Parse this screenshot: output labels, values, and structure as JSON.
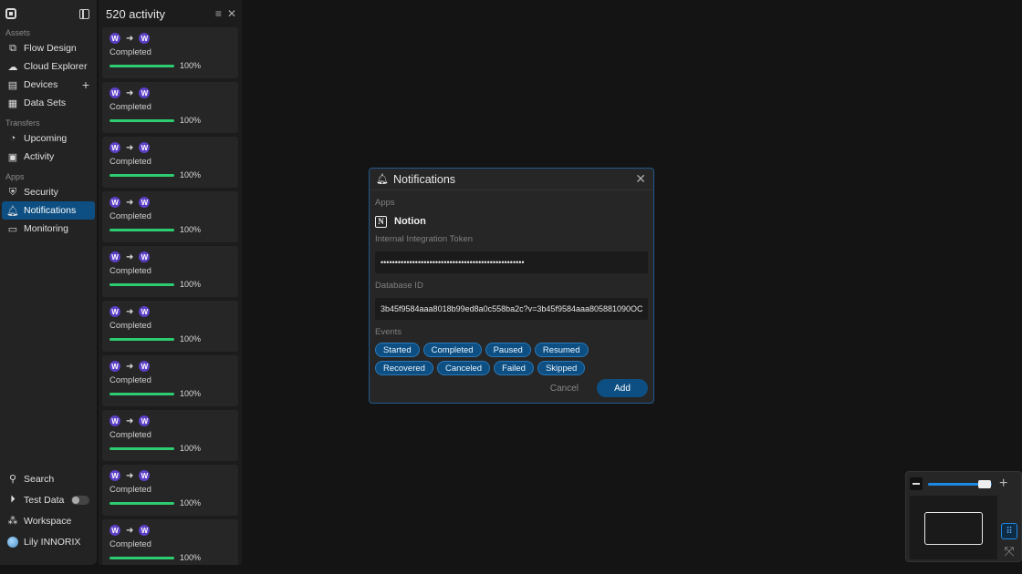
{
  "sidebar": {
    "sections": [
      {
        "label": "Assets",
        "items": [
          {
            "label": "Flow Design",
            "icon": "flow-icon"
          },
          {
            "label": "Cloud Explorer",
            "icon": "cloud-icon"
          },
          {
            "label": "Devices",
            "icon": "devices-icon"
          },
          {
            "label": "Data Sets",
            "icon": "dataset-icon"
          }
        ]
      },
      {
        "label": "Transfers",
        "items": [
          {
            "label": "Upcoming",
            "icon": "clock-icon"
          },
          {
            "label": "Activity",
            "icon": "activity-icon"
          }
        ]
      },
      {
        "label": "Apps",
        "items": [
          {
            "label": "Security",
            "icon": "shield-icon"
          },
          {
            "label": "Notifications",
            "icon": "bell-icon",
            "active": true
          },
          {
            "label": "Monitoring",
            "icon": "monitor-icon"
          }
        ]
      }
    ],
    "bottom": {
      "search": "Search",
      "test_data": "Test Data",
      "workspace": "Workspace",
      "user": "Lily INNORIX"
    }
  },
  "activity": {
    "title": "520  activity",
    "items": [
      {
        "from": "W",
        "to": "W",
        "status": "Completed",
        "progress": 100,
        "progress_label": "100%"
      },
      {
        "from": "W",
        "to": "W",
        "status": "Completed",
        "progress": 100,
        "progress_label": "100%"
      },
      {
        "from": "W",
        "to": "W",
        "status": "Completed",
        "progress": 100,
        "progress_label": "100%"
      },
      {
        "from": "W",
        "to": "W",
        "status": "Completed",
        "progress": 100,
        "progress_label": "100%"
      },
      {
        "from": "W",
        "to": "W",
        "status": "Completed",
        "progress": 100,
        "progress_label": "100%"
      },
      {
        "from": "W",
        "to": "W",
        "status": "Completed",
        "progress": 100,
        "progress_label": "100%"
      },
      {
        "from": "W",
        "to": "W",
        "status": "Completed",
        "progress": 100,
        "progress_label": "100%"
      },
      {
        "from": "W",
        "to": "W",
        "status": "Completed",
        "progress": 100,
        "progress_label": "100%"
      },
      {
        "from": "W",
        "to": "W",
        "status": "Completed",
        "progress": 100,
        "progress_label": "100%"
      },
      {
        "from": "W",
        "to": "W",
        "status": "Completed",
        "progress": 100,
        "progress_label": "100%"
      }
    ]
  },
  "modal": {
    "title": "Notifications",
    "apps_label": "Apps",
    "app_name": "Notion",
    "token_label": "Internal Integration Token",
    "token_value": "••••••••••••••••••••••••••••••••••••••••••••••••••",
    "db_label": "Database ID",
    "db_value": "3b45f9584aaa8018b99ed8a0c558ba2c?v=3b45f9584aaa805881090OC",
    "events_label": "Events",
    "events": [
      "Started",
      "Completed",
      "Paused",
      "Resumed",
      "Recovered",
      "Canceled",
      "Failed",
      "Skipped"
    ],
    "cancel": "Cancel",
    "add": "Add"
  },
  "minimap": {
    "zoom_level": 0.95
  },
  "colors": {
    "accent": "#0d4f82",
    "progress": "#2ecc71",
    "badge": "#5b3fc6"
  }
}
